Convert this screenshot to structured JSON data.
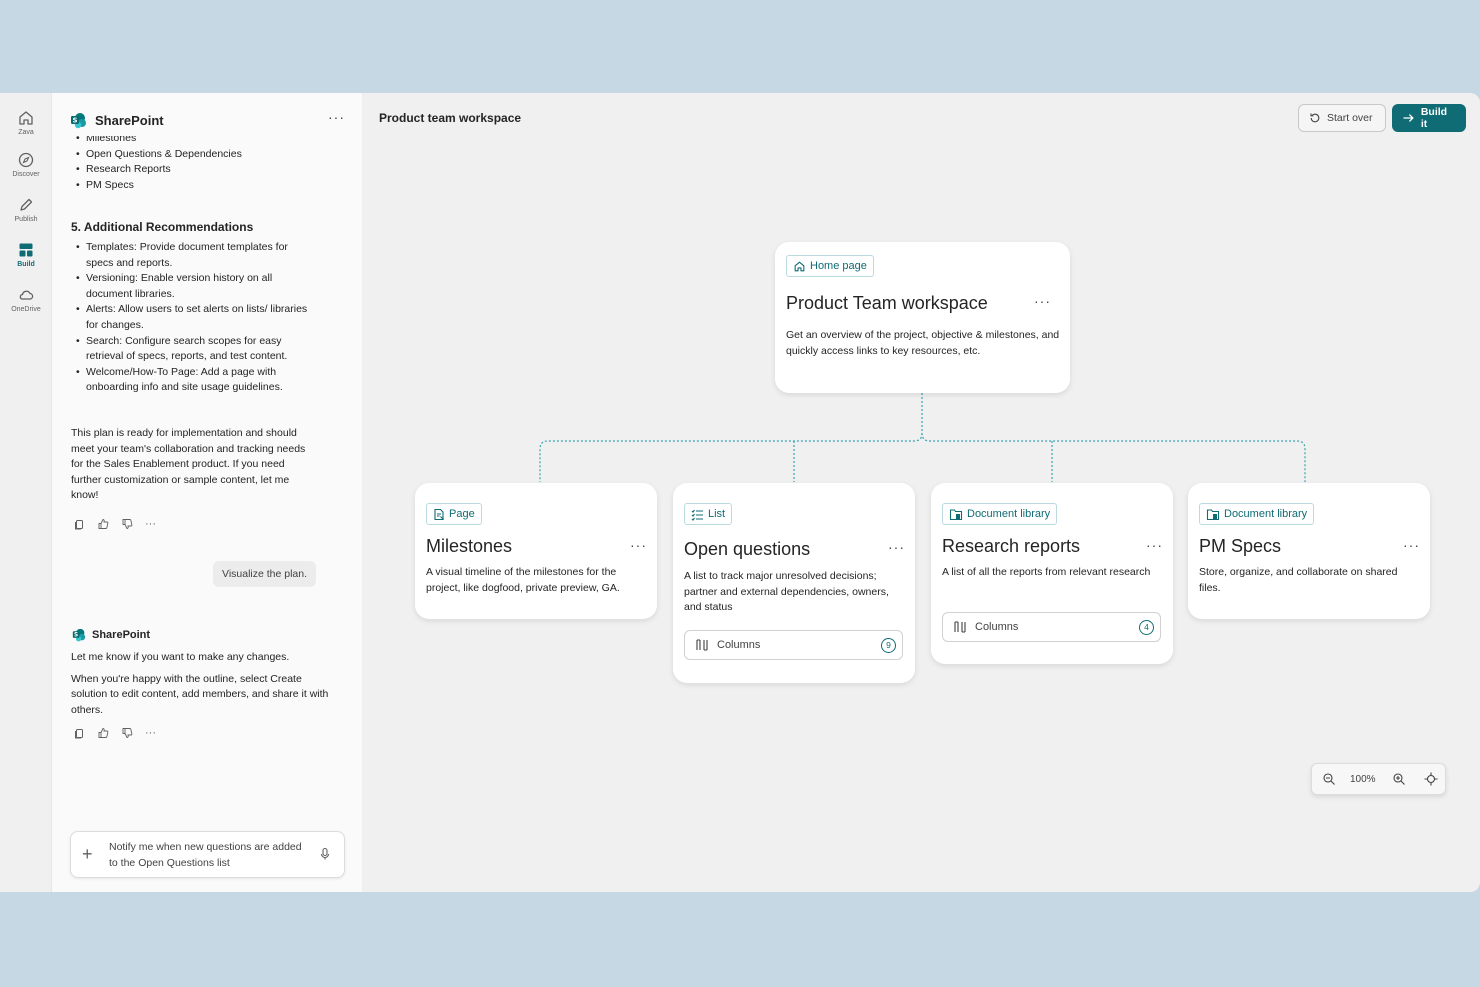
{
  "rail": {
    "items": [
      {
        "label": "Zava",
        "icon": "home-icon"
      },
      {
        "label": "Discover",
        "icon": "compass-icon"
      },
      {
        "label": "Publish",
        "icon": "pen-icon"
      },
      {
        "label": "Build",
        "icon": "build-icon",
        "active": true
      },
      {
        "label": "OneDrive",
        "icon": "cloud-icon"
      }
    ]
  },
  "chat": {
    "app_name": "SharePoint",
    "more": "···",
    "prev_list": [
      "Milestones",
      "Open Questions & Dependencies",
      "Research Reports",
      "PM Specs"
    ],
    "section_title": "5. Additional Recommendations",
    "recommendations": [
      "Templates: Provide document templates for specs and reports.",
      "Versioning: Enable version history on all document libraries.",
      "Alerts: Allow users to set alerts on lists/ libraries for changes.",
      "Search: Configure search scopes for easy retrieval of specs, reports, and test content.",
      "Welcome/How-To Page: Add a page with onboarding info and site usage guidelines."
    ],
    "summary": "This plan is ready for implementation and should meet your team's collaboration and tracking needs for the Sales Enablement product. If you need further customization or sample content, let me know!",
    "user_message": "Visualize the plan.",
    "bot_name": "SharePoint",
    "bot_p1": "Let me know if you want to make any changes.",
    "bot_p2": "When you're happy with the outline, select Create solution to edit content, add members, and share it with others.",
    "composer_text": "Notify me when new questions are added to the Open Questions list",
    "composer_plus": "+"
  },
  "canvas": {
    "title": "Product team workspace",
    "start_over": "Start over",
    "build_it": "Build it",
    "zoom_level": "100%",
    "accent_color": "#0f6b74"
  },
  "cards": {
    "home": {
      "tag": "Home page",
      "title": "Product Team workspace",
      "desc": "Get an overview of the project, objective & milestones, and quickly access links to key resources, etc.",
      "more": "···"
    },
    "milestones": {
      "tag": "Page",
      "title": "Milestones",
      "desc": "A visual timeline of the milestones for the project, like dogfood, private preview, GA.",
      "more": "···"
    },
    "open_questions": {
      "tag": "List",
      "title": "Open questions",
      "desc": "A list to track major unresolved decisions; partner and external dependencies, owners, and status",
      "columns_label": "Columns",
      "columns_count": "9",
      "more": "···"
    },
    "research": {
      "tag": "Document library",
      "title": "Research reports",
      "desc": "A list of all the reports from relevant research",
      "columns_label": "Columns",
      "columns_count": "4",
      "more": "···"
    },
    "pm_specs": {
      "tag": "Document library",
      "title": "PM Specs",
      "desc": "Store, organize, and collaborate on shared files.",
      "more": "···"
    }
  }
}
